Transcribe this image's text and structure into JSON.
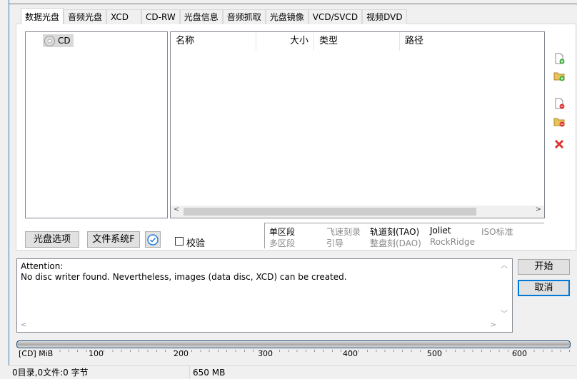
{
  "tabs": [
    "数据光盘",
    "音频光盘",
    "XCD",
    "CD-RW",
    "光盘信息",
    "音频抓取",
    "光盘镜像",
    "VCD/SVCD",
    "视频DVD"
  ],
  "tree": {
    "root": "CD"
  },
  "list": {
    "columns": [
      "名称",
      "大小",
      "类型",
      "路径"
    ]
  },
  "buttons": {
    "disc_options": "光盘选项",
    "filesystem": "文件系统F",
    "verify_label": "校验",
    "start": "开始",
    "cancel": "取消"
  },
  "options": {
    "single_session": "单区段",
    "multi_session": "多区段",
    "burnproof": "飞速刻录",
    "leadin": "引导",
    "tao": "轨道刻(TAO)",
    "dao": "整盘刻(DAO)",
    "joliet": "Joliet",
    "rockridge": "RockRidge",
    "iso": "ISO标准"
  },
  "log": {
    "line1": "Attention:",
    "line2": "No disc writer found. Nevertheless, images (data disc, XCD) can be created."
  },
  "scale": {
    "unit": "[CD] MiB",
    "ticks": [
      "100",
      "200",
      "300",
      "400",
      "500",
      "600"
    ]
  },
  "progress": {
    "fraction": 0
  },
  "status": {
    "summary": "0目录,0文件:0 字节",
    "capacity": "650 MB"
  }
}
